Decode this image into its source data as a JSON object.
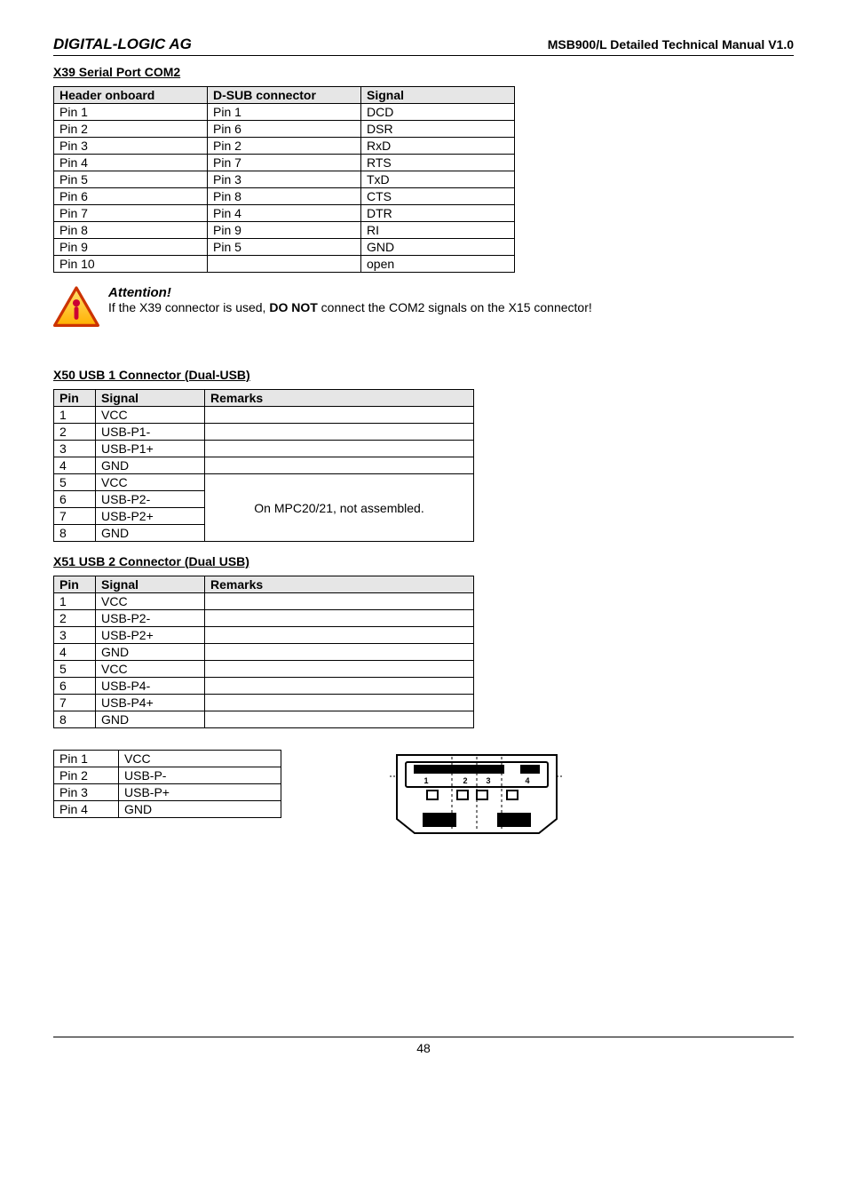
{
  "header": {
    "left": "DIGITAL-LOGIC AG",
    "right": "MSB900/L Detailed Technical Manual V1.0"
  },
  "x39": {
    "title": "X39    Serial Port COM2",
    "cols": [
      "Header onboard",
      "D-SUB connector",
      "Signal"
    ],
    "rows": [
      [
        "Pin 1",
        "Pin 1",
        "DCD"
      ],
      [
        "Pin 2",
        "Pin 6",
        "DSR"
      ],
      [
        "Pin 3",
        "Pin 2",
        "RxD"
      ],
      [
        "Pin 4",
        "Pin 7",
        "RTS"
      ],
      [
        "Pin 5",
        "Pin 3",
        "TxD"
      ],
      [
        "Pin 6",
        "Pin 8",
        "CTS"
      ],
      [
        "Pin 7",
        "Pin 4",
        "DTR"
      ],
      [
        "Pin 8",
        "Pin 9",
        "RI"
      ],
      [
        "Pin 9",
        "Pin 5",
        "GND"
      ],
      [
        "Pin 10",
        "",
        "open"
      ]
    ]
  },
  "attention": {
    "title": "Attention!",
    "text_pre": "If the X39 connector is used, ",
    "text_bold": "DO NOT",
    "text_post": " connect the COM2 signals on the X15 connector!"
  },
  "x50": {
    "title": "X50    USB 1 Connector (Dual-USB)",
    "cols": [
      "Pin",
      "Signal",
      "Remarks"
    ],
    "rows": [
      [
        "1",
        "VCC",
        ""
      ],
      [
        "2",
        "USB-P1-",
        ""
      ],
      [
        "3",
        "USB-P1+",
        ""
      ],
      [
        "4",
        "GND",
        ""
      ],
      [
        "5",
        "VCC",
        ""
      ],
      [
        "6",
        "USB-P2-",
        ""
      ],
      [
        "7",
        "USB-P2+",
        ""
      ],
      [
        "8",
        "GND",
        ""
      ]
    ],
    "merged_remark": "On MPC20/21, not assembled."
  },
  "x51": {
    "title": "X51    USB 2 Connector (Dual USB)",
    "cols": [
      "Pin",
      "Signal",
      "Remarks"
    ],
    "rows": [
      [
        "1",
        "VCC",
        ""
      ],
      [
        "2",
        "USB-P2-",
        ""
      ],
      [
        "3",
        "USB-P2+",
        ""
      ],
      [
        "4",
        "GND",
        ""
      ],
      [
        "5",
        "VCC",
        ""
      ],
      [
        "6",
        "USB-P4-",
        ""
      ],
      [
        "7",
        "USB-P4+",
        ""
      ],
      [
        "8",
        "GND",
        ""
      ]
    ]
  },
  "usb_pinout": {
    "rows": [
      [
        "Pin 1",
        "VCC"
      ],
      [
        "Pin 2",
        "USB-P-"
      ],
      [
        "Pin 3",
        "USB-P+"
      ],
      [
        "Pin 4",
        "GND"
      ]
    ],
    "diagram_labels": [
      "1",
      "2",
      "3",
      "4"
    ]
  },
  "footer": {
    "page": "48"
  }
}
